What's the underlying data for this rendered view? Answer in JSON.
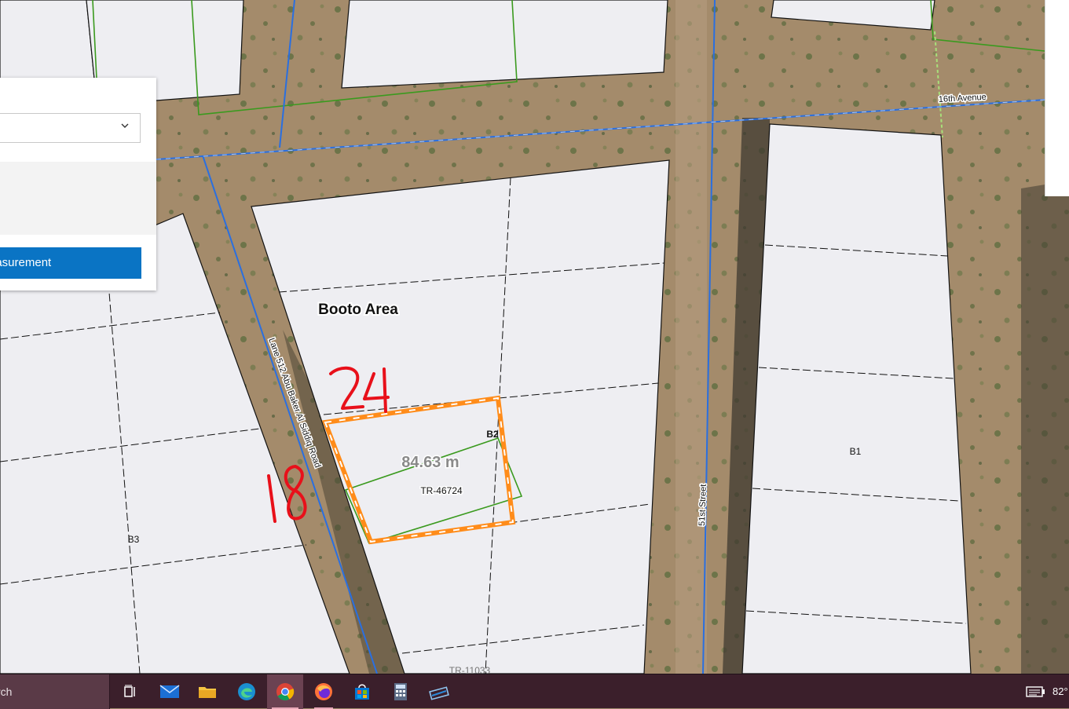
{
  "map": {
    "area_label": "Booto Area",
    "measurement_label": "84.63 m",
    "parcel_labels": {
      "tr_main": "TR-46724",
      "tr_bottom": "TR-11033",
      "b1": "B1",
      "b2": "B2",
      "b3": "B3"
    },
    "road_labels": {
      "lane": "Lane 512 Abu Baker Al Siddiq Road",
      "street": "51st Street",
      "avenue": "16th Avenue"
    },
    "handwritten": {
      "top": "24",
      "left": "18"
    },
    "colors": {
      "parcel_fill": "#eeeef2",
      "measure_line": "#ff8c1a",
      "road_line": "#2a6fe0",
      "plot_line": "#3a9a1e",
      "annotation": "#e8101a"
    }
  },
  "panel": {
    "button_label": "easurement"
  },
  "taskbar": {
    "search_text": "rch",
    "icons": [
      "task-view-icon",
      "mail-icon",
      "file-explorer-icon",
      "edge-icon",
      "chrome-icon",
      "firefox-icon",
      "store-icon",
      "calculator-icon",
      "snipping-tool-icon"
    ],
    "active_icon": "chrome-icon",
    "temperature": "82°"
  }
}
